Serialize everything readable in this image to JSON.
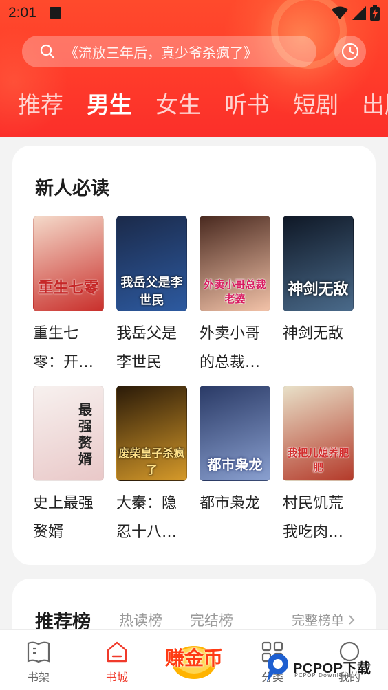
{
  "status": {
    "time": "2:01"
  },
  "search": {
    "placeholder": "《流放三年后，真少爷杀疯了》"
  },
  "tabs": [
    {
      "label": "推荐",
      "active": false
    },
    {
      "label": "男生",
      "active": true
    },
    {
      "label": "女生",
      "active": false
    },
    {
      "label": "听书",
      "active": false
    },
    {
      "label": "短剧",
      "active": false
    },
    {
      "label": "出版",
      "active": false
    }
  ],
  "newcomer": {
    "title": "新人必读",
    "books": [
      {
        "title": "重生七零：开…",
        "cover_text": "重生七零",
        "cover_colors": [
          "#f4d9c9",
          "#c9302c"
        ]
      },
      {
        "title": "我岳父是李世民",
        "cover_text": "我岳父是李世民",
        "cover_colors": [
          "#1b2a4a",
          "#2d5aa0"
        ]
      },
      {
        "title": "外卖小哥的总裁…",
        "cover_text": "外卖小哥总裁老婆",
        "cover_colors": [
          "#4a2a20",
          "#f2c2a8"
        ]
      },
      {
        "title": "神剑无敌",
        "cover_text": "神剑无敌",
        "cover_colors": [
          "#0f1826",
          "#4a6a8a"
        ]
      },
      {
        "title": "史上最强赘婿",
        "cover_text": "最强赘婿",
        "cover_colors": [
          "#f7f1ef",
          "#e9c8c8"
        ]
      },
      {
        "title": "大秦：隐忍十八…",
        "cover_text": "废柴皇子杀疯了",
        "cover_colors": [
          "#2a1a08",
          "#d69a2a"
        ]
      },
      {
        "title": "都市枭龙",
        "cover_text": "都市枭龙",
        "cover_colors": [
          "#2a3a66",
          "#8aa0d0"
        ]
      },
      {
        "title": "村民饥荒我吃肉…",
        "cover_text": "我把儿媳养肥肥",
        "cover_colors": [
          "#e8e0c8",
          "#b43a2a"
        ]
      }
    ]
  },
  "ranking": {
    "title": "推荐榜",
    "tabs": [
      "热读榜",
      "完结榜"
    ],
    "more": "完整榜单"
  },
  "coin_button": {
    "label": "赚金币"
  },
  "bottom_nav": [
    {
      "label": "书架",
      "icon": "bookshelf-icon",
      "active": false
    },
    {
      "label": "书城",
      "icon": "bookstore-icon",
      "active": true
    },
    {
      "label": "分类",
      "icon": "category-icon",
      "active": false
    },
    {
      "label": "我的",
      "icon": "profile-icon",
      "active": false
    }
  ],
  "watermark": {
    "text": "PCPOP下载",
    "sub": "PCPOP Download"
  }
}
